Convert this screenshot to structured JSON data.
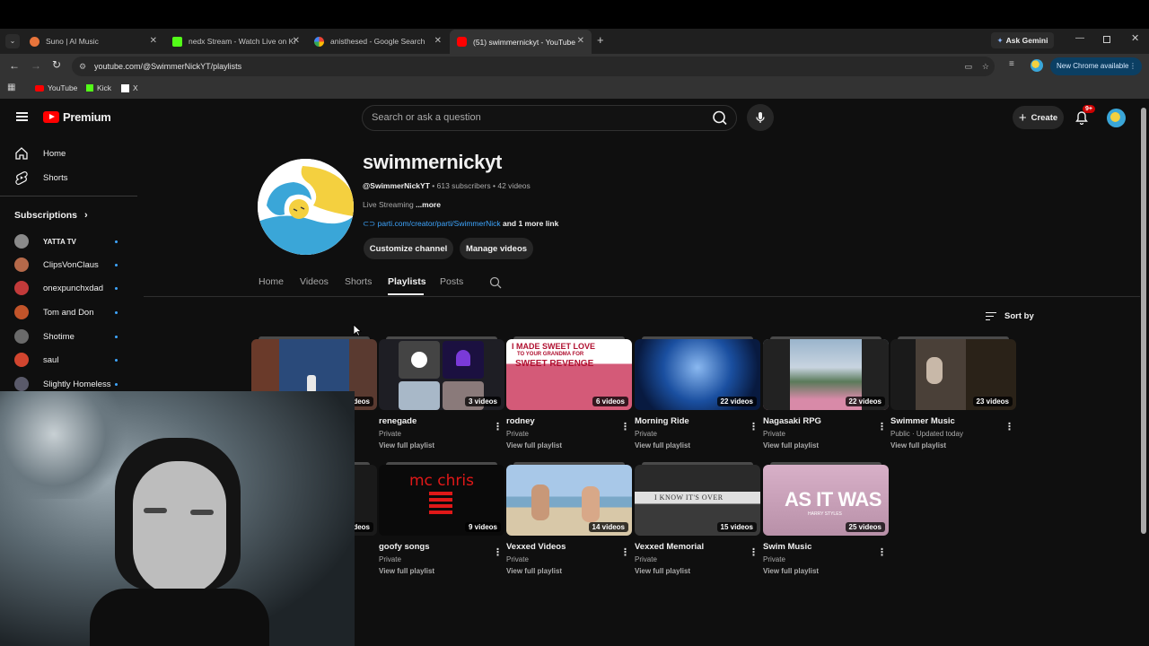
{
  "browser": {
    "tabs": [
      {
        "title": "Suno | AI Music",
        "favicon_color": "#e8743b"
      },
      {
        "title": "nedx Stream - Watch Live on Ki",
        "favicon_color": "#53fc18"
      },
      {
        "title": "anisthesed - Google Search",
        "favicon_color": "#4285f4"
      },
      {
        "title": "(51) swimmernickyt - YouTube",
        "favicon_color": "#ff0000"
      }
    ],
    "ask_gemini": "Ask Gemini",
    "url": "youtube.com/@SwimmerNickYT/playlists",
    "new_chrome": "New Chrome available",
    "bookmarks": [
      "YouTube",
      "Kick",
      "X"
    ]
  },
  "youtube": {
    "logo_text": "Premium",
    "search_placeholder": "Search or ask a question",
    "create_label": "Create",
    "notification_count": "9+",
    "sidebar": {
      "home": "Home",
      "shorts": "Shorts",
      "subscriptions_label": "Subscriptions",
      "subscriptions": [
        {
          "name": "YATTA TV",
          "color": "#8a8a8a"
        },
        {
          "name": "ClipsVonClaus",
          "color": "#b5694a"
        },
        {
          "name": "onexpunchxdad",
          "color": "#c23a3a"
        },
        {
          "name": "Tom and Don",
          "color": "#c2542a"
        },
        {
          "name": "Shotime",
          "color": "#6a6a6a"
        },
        {
          "name": "saul",
          "color": "#d1452f"
        },
        {
          "name": "Slightly Homeless",
          "color": "#5a5a6a"
        }
      ]
    },
    "channel": {
      "name": "swimmernickyt",
      "handle": "@SwimmerNickYT",
      "subscribers": "613 subscribers",
      "videos": "42 videos",
      "description": "Live Streaming",
      "more": "...more",
      "link": "parti.com/creator/parti/SwimmerNick",
      "more_links": "and 1 more link",
      "customize_button": "Customize channel",
      "manage_button": "Manage videos",
      "tabs": [
        "Home",
        "Videos",
        "Shorts",
        "Playlists",
        "Posts"
      ],
      "sort_label": "Sort by"
    },
    "playlists_row1": [
      {
        "title": "",
        "count": "ideos",
        "privacy": "",
        "view": "",
        "color": "#2a4a7a"
      },
      {
        "title": "renegade",
        "count": "3 videos",
        "privacy": "Private",
        "view": "View full playlist",
        "color": "#3a3a4a"
      },
      {
        "title": "rodney",
        "count": "6 videos",
        "privacy": "Private",
        "view": "View full playlist",
        "color": "#c94a5a"
      },
      {
        "title": "Morning Ride",
        "count": "22 videos",
        "privacy": "Private",
        "view": "View full playlist",
        "color": "#1a4fa0"
      },
      {
        "title": "Nagasaki RPG",
        "count": "22 videos",
        "privacy": "Private",
        "view": "View full playlist",
        "color": "#6a8aa8"
      },
      {
        "title": "Swimmer Music",
        "count": "23 videos",
        "privacy": "Public · Updated today",
        "view": "View full playlist",
        "color": "#3a332b"
      }
    ],
    "playlists_row2": [
      {
        "title": "",
        "count": "ideos",
        "privacy": "",
        "view": "",
        "color": "#1a1a1a"
      },
      {
        "title": "goofy songs",
        "count": "9 videos",
        "privacy": "Private",
        "view": "View full playlist",
        "color": "#0a0a0a"
      },
      {
        "title": "Vexxed Videos",
        "count": "14 videos",
        "privacy": "Private",
        "view": "View full playlist",
        "color": "#8aa8c8"
      },
      {
        "title": "Vexxed Memorial",
        "count": "15 videos",
        "privacy": "Private",
        "view": "View full playlist",
        "color": "#4a4a4a"
      },
      {
        "title": "Swim Music",
        "count": "25 videos",
        "privacy": "Private",
        "view": "View full playlist",
        "color": "#c9a0b8"
      }
    ],
    "thumb_texts": {
      "rodney_top": "I MADE SWEET LOVE",
      "rodney_mid": "TO YOUR GRANDMA FOR",
      "rodney_big": "SWEET REVENGE",
      "goofy": "mc chris",
      "memorial": "I KNOW IT'S OVER",
      "swim": "AS IT WAS",
      "swim_sub": "HARRY STYLES"
    }
  }
}
